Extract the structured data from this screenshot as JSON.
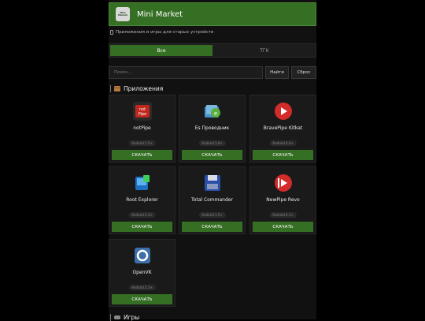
{
  "header": {
    "title": "Mini Market",
    "logo_text": "Mini Market"
  },
  "subtitle": "Приложения и игры для старых устройств",
  "tabs": [
    {
      "label": "Все",
      "active": true
    },
    {
      "label": "ТГК",
      "active": false
    }
  ],
  "search": {
    "placeholder": "Поиск...",
    "find_label": "Найти",
    "reset_label": "Сброс"
  },
  "sections": {
    "apps": "Приложения",
    "games": "Игры"
  },
  "apps": [
    {
      "name": "notPipe",
      "requirement": "Android 1.5+",
      "download_label": "СКАЧАТЬ",
      "icon": "notpipe-icon"
    },
    {
      "name": "Es Проводник",
      "requirement": "Android 1.6+",
      "download_label": "СКАЧАТЬ",
      "icon": "es-explorer-icon"
    },
    {
      "name": "BravePipe Kitkat",
      "requirement": "Android 4.4+",
      "download_label": "СКАЧАТЬ",
      "icon": "bravepipe-icon"
    },
    {
      "name": "Root Explorer",
      "requirement": "Android 2.3+",
      "download_label": "СКАЧАТЬ",
      "icon": "root-explorer-icon"
    },
    {
      "name": "Total Commander",
      "requirement": "Android 1.5+",
      "download_label": "СКАЧАТЬ",
      "icon": "total-commander-icon"
    },
    {
      "name": "NewPipe Revo",
      "requirement": "Android 4.1+",
      "download_label": "СКАЧАТЬ",
      "icon": "newpipe-icon"
    },
    {
      "name": "OpenVK",
      "requirement": "Android 2.1+",
      "download_label": "СКАЧАТЬ",
      "icon": "openvk-icon"
    }
  ],
  "colors": {
    "accent": "#356f24",
    "background": "#000000",
    "card": "#1a1a1a"
  }
}
